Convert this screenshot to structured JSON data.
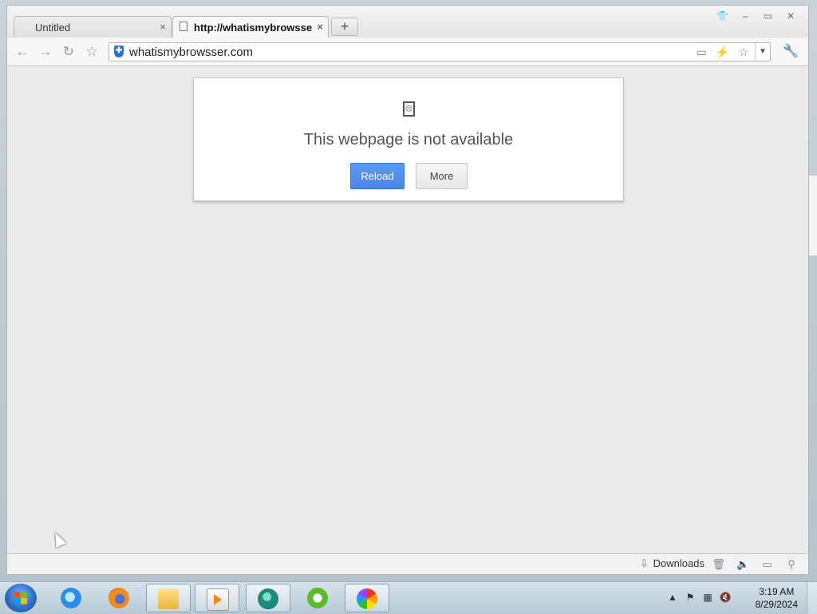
{
  "tabs": [
    {
      "label": "Untitled",
      "close": "×"
    },
    {
      "label": "http://whatismybrowsse",
      "close": "×"
    }
  ],
  "newtab": {
    "label": "+"
  },
  "window_controls": {
    "shirt": "👕",
    "minimize": "–",
    "maximize": "▭",
    "close": "✕"
  },
  "toolbar": {
    "back": "←",
    "forward": "→",
    "reload": "↻",
    "home": "☆",
    "url": "whatismybrowsser.com",
    "shield_glyph": "✚",
    "omni_icons": {
      "screen": "▭",
      "bolt": "⚡",
      "star": "☆"
    },
    "dropdown": "▼",
    "wrench": "🔧"
  },
  "error": {
    "sad_icon": "☹",
    "title": "This webpage is not available",
    "reload_label": "Reload",
    "more_label": "More"
  },
  "statusbar": {
    "downloads_label": "Downloads",
    "download_icon": "⇩",
    "icons": {
      "trash": "🗑",
      "volume": "🔈",
      "tablet": "▭",
      "zoom": "⚲"
    }
  },
  "taskbar": {
    "tray": {
      "chevron": "▲",
      "flag": "⚑",
      "network": "▦",
      "volume": "🔇"
    },
    "time": "3:19 AM",
    "date": "8/29/2024"
  }
}
